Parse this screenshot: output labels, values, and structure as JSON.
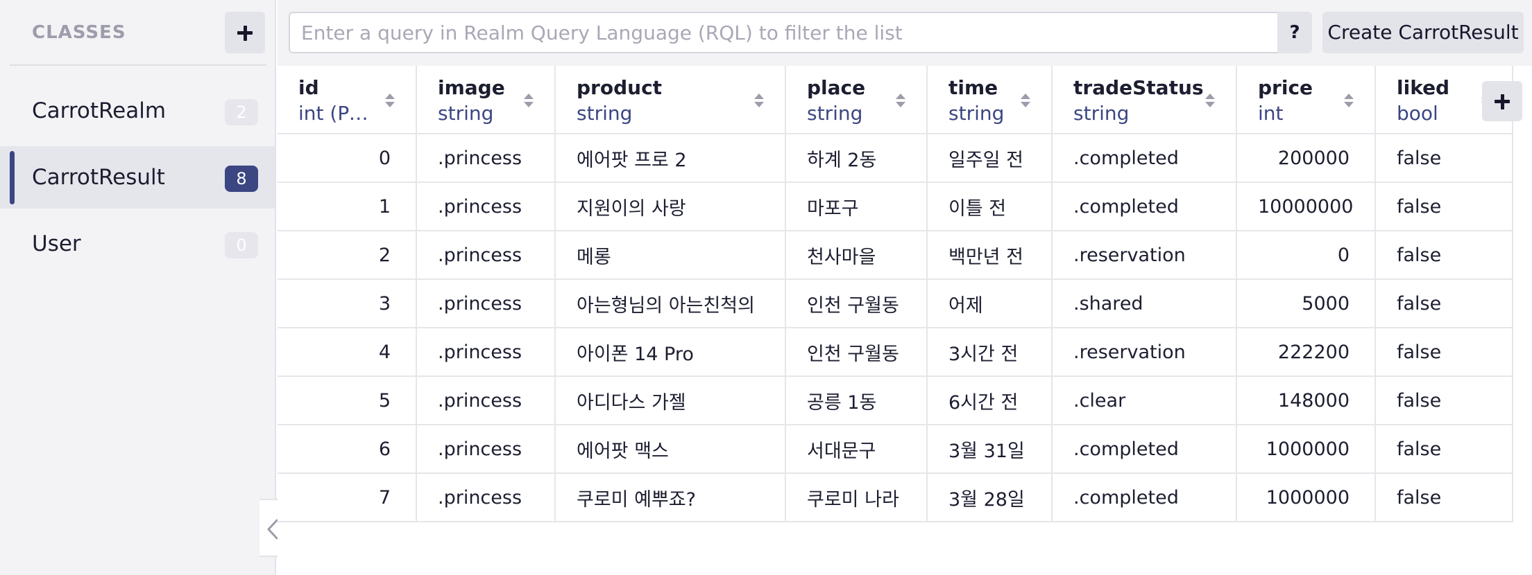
{
  "sidebar": {
    "title": "CLASSES",
    "add_icon": "plus-icon",
    "items": [
      {
        "label": "CarrotRealm",
        "count": "2",
        "selected": false
      },
      {
        "label": "CarrotResult",
        "count": "8",
        "selected": true
      },
      {
        "label": "User",
        "count": "0",
        "selected": false
      }
    ],
    "collapse_icon": "chevron-left-icon"
  },
  "topbar": {
    "search_placeholder": "Enter a query in Realm Query Language (RQL) to filter the list",
    "help_label": "?",
    "create_label": "Create CarrotResult"
  },
  "table": {
    "columns": [
      {
        "name": "id",
        "type": "int (Primary Key)"
      },
      {
        "name": "image",
        "type": "string"
      },
      {
        "name": "product",
        "type": "string"
      },
      {
        "name": "place",
        "type": "string"
      },
      {
        "name": "time",
        "type": "string"
      },
      {
        "name": "tradeStatus",
        "type": "string"
      },
      {
        "name": "price",
        "type": "int"
      },
      {
        "name": "liked",
        "type": "bool"
      }
    ],
    "rows": [
      [
        "0",
        ".princess",
        "에어팟 프로 2",
        "하계 2동",
        "일주일 전",
        ".completed",
        "200000",
        "false"
      ],
      [
        "1",
        ".princess",
        "지원이의 사랑",
        "마포구",
        "이틀 전",
        ".completed",
        "10000000",
        "false"
      ],
      [
        "2",
        ".princess",
        "메롱",
        "천사마을",
        "백만년 전",
        ".reservation",
        "0",
        "false"
      ],
      [
        "3",
        ".princess",
        "아는형님의 아는친척의",
        "인천 구월동",
        "어제",
        ".shared",
        "5000",
        "false"
      ],
      [
        "4",
        ".princess",
        "아이폰 14 Pro",
        "인천 구월동",
        "3시간 전",
        ".reservation",
        "222200",
        "false"
      ],
      [
        "5",
        ".princess",
        "아디다스 가젤",
        "공릉 1동",
        "6시간 전",
        ".clear",
        "148000",
        "false"
      ],
      [
        "6",
        ".princess",
        "에어팟 맥스",
        "서대문구",
        "3월 31일",
        ".completed",
        "1000000",
        "false"
      ],
      [
        "7",
        ".princess",
        "쿠로미 예뿌죠?",
        "쿠로미 나라",
        "3월 28일",
        ".completed",
        "1000000",
        "false"
      ]
    ],
    "add_column_icon": "plus-icon"
  },
  "colors": {
    "accent": "#3b4682",
    "sidebar_bg": "#f3f3f6",
    "type_text": "#3b4682"
  }
}
